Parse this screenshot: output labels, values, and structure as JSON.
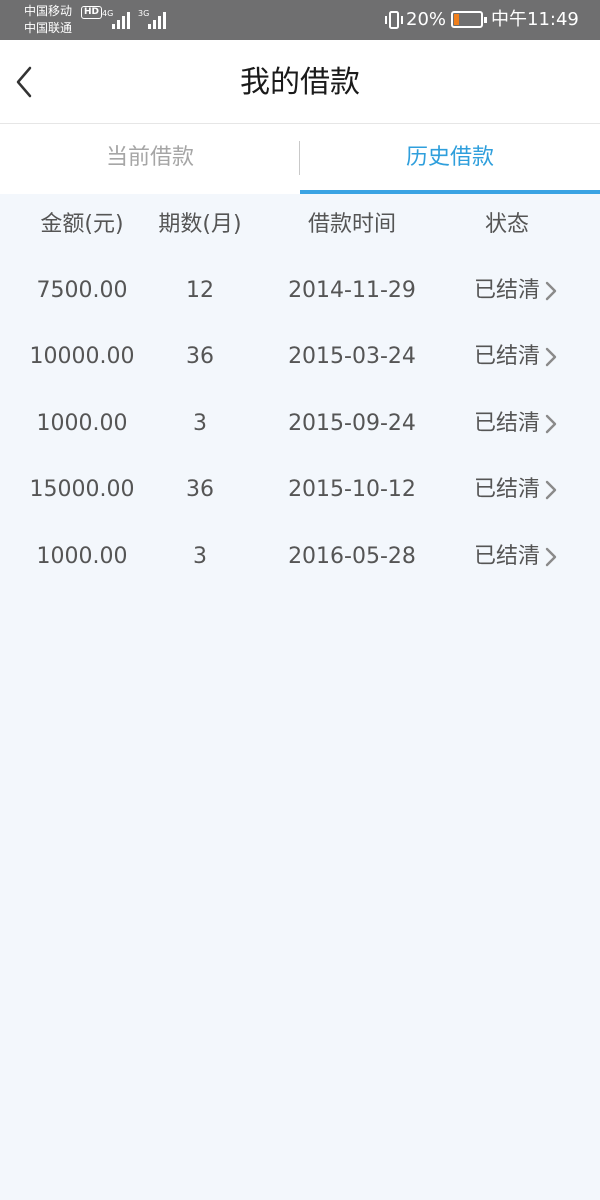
{
  "status_bar": {
    "carrier1": "中国移动",
    "carrier2": "中国联通",
    "hd": "HD",
    "network1": "4G",
    "network2": "3G",
    "battery_percent": "20%",
    "battery_level": 0.2,
    "battery_color": "#f07f1c",
    "time": "中午11:49"
  },
  "header": {
    "title": "我的借款",
    "back_icon": "chevron-left-icon"
  },
  "tabs": [
    {
      "label": "当前借款",
      "active": false
    },
    {
      "label": "历史借款",
      "active": true
    }
  ],
  "accent_color": "#3aa3e3",
  "table": {
    "columns": [
      "金额(元)",
      "期数(月)",
      "借款时间",
      "状态"
    ],
    "rows": [
      {
        "amount": "7500.00",
        "months": "12",
        "date": "2014-11-29",
        "status": "已结清"
      },
      {
        "amount": "10000.00",
        "months": "36",
        "date": "2015-03-24",
        "status": "已结清"
      },
      {
        "amount": "1000.00",
        "months": "3",
        "date": "2015-09-24",
        "status": "已结清"
      },
      {
        "amount": "15000.00",
        "months": "36",
        "date": "2015-10-12",
        "status": "已结清"
      },
      {
        "amount": "1000.00",
        "months": "3",
        "date": "2016-05-28",
        "status": "已结清"
      }
    ]
  }
}
